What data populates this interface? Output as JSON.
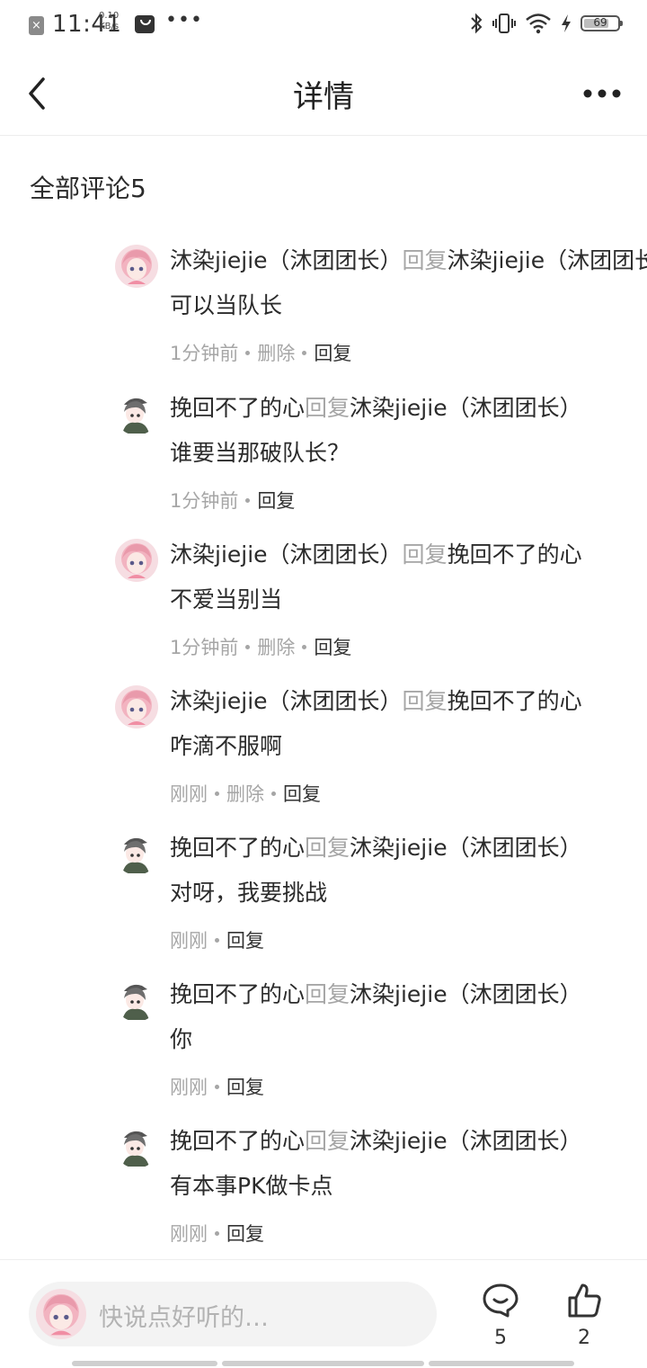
{
  "status": {
    "time": "11:41",
    "speed_value": "0.10",
    "speed_unit": "KB/s",
    "battery": "69"
  },
  "header": {
    "title": "详情"
  },
  "comments_section": {
    "title": "全部评论5"
  },
  "comments": [
    {
      "author": "沐染jiejie（沐团团长）",
      "reply_word": "回复",
      "target": "沐染jiejie（沐团团长）",
      "text": "可以当队长",
      "time": "1分钟前",
      "delete": "删除",
      "reply": "回复",
      "avatar": "pink-hair-avatar"
    },
    {
      "author": "挽回不了的心",
      "reply_word": "回复",
      "target": "沐染jiejie（沐团团长）",
      "text": "谁要当那破队长？",
      "time": "1分钟前",
      "reply": "回复",
      "avatar": "dark-hair-avatar"
    },
    {
      "author": "沐染jiejie（沐团团长）",
      "reply_word": "回复",
      "target": "挽回不了的心",
      "text": "不爱当别当",
      "time": "1分钟前",
      "delete": "删除",
      "reply": "回复",
      "avatar": "pink-hair-avatar"
    },
    {
      "author": "沐染jiejie（沐团团长）",
      "reply_word": "回复",
      "target": "挽回不了的心",
      "text": "咋滴不服啊",
      "time": "刚刚",
      "delete": "删除",
      "reply": "回复",
      "avatar": "pink-hair-avatar"
    },
    {
      "author": "挽回不了的心",
      "reply_word": "回复",
      "target": "沐染jiejie（沐团团长）",
      "text": "对呀，我要挑战",
      "time": "刚刚",
      "reply": "回复",
      "avatar": "dark-hair-avatar"
    },
    {
      "author": "挽回不了的心",
      "reply_word": "回复",
      "target": "沐染jiejie（沐团团长）",
      "text": "你",
      "time": "刚刚",
      "reply": "回复",
      "avatar": "dark-hair-avatar"
    },
    {
      "author": "挽回不了的心",
      "reply_word": "回复",
      "target": "沐染jiejie（沐团团长）",
      "text": "有本事PK做卡点",
      "time": "刚刚",
      "reply": "回复",
      "avatar": "dark-hair-avatar"
    }
  ],
  "bottom_bar": {
    "input_placeholder": "快说点好听的…",
    "comment_count": "5",
    "like_count": "2"
  }
}
